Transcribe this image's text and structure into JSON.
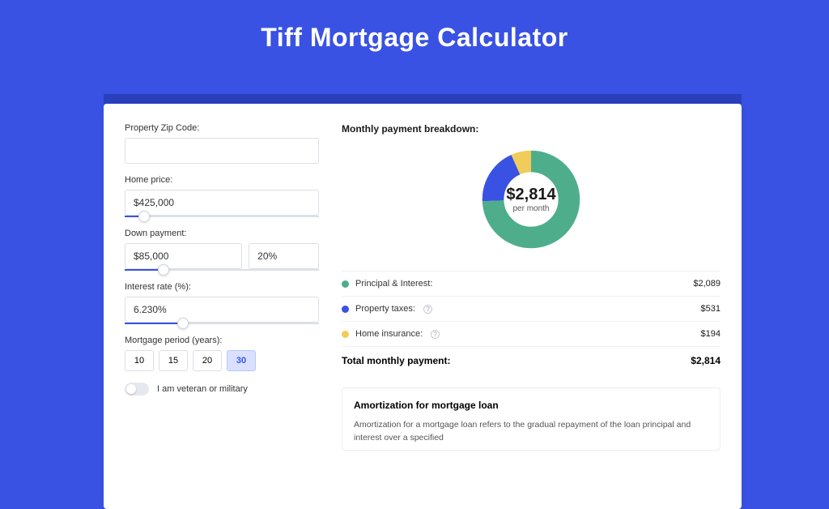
{
  "page": {
    "title": "Tiff Mortgage Calculator"
  },
  "form": {
    "zip_label": "Property Zip Code:",
    "zip_value": "",
    "home_price_label": "Home price:",
    "home_price_value": "$425,000",
    "home_price_slider_pct": 10,
    "down_label": "Down payment:",
    "down_value": "$85,000",
    "down_pct_value": "20%",
    "down_slider_pct": 20,
    "rate_label": "Interest rate (%):",
    "rate_value": "6.230%",
    "rate_slider_pct": 30,
    "period_label": "Mortgage period (years):",
    "period_options": [
      "10",
      "15",
      "20",
      "30"
    ],
    "period_selected": "30",
    "veteran_label": "I am veteran or military",
    "veteran_on": false
  },
  "breakdown": {
    "title": "Monthly payment breakdown:",
    "center_amount": "$2,814",
    "center_sub": "per month",
    "items": [
      {
        "label": "Principal & Interest:",
        "value": "$2,089",
        "color": "green",
        "info": false
      },
      {
        "label": "Property taxes:",
        "value": "$531",
        "color": "blue",
        "info": true
      },
      {
        "label": "Home insurance:",
        "value": "$194",
        "color": "yellow",
        "info": true
      }
    ],
    "total_label": "Total monthly payment:",
    "total_value": "$2,814"
  },
  "chart_data": {
    "type": "pie",
    "title": "Monthly payment breakdown",
    "series": [
      {
        "name": "Principal & Interest",
        "value": 2089,
        "color": "#4eae8c"
      },
      {
        "name": "Property taxes",
        "value": 531,
        "color": "#3952e3"
      },
      {
        "name": "Home insurance",
        "value": 194,
        "color": "#f0cc5a"
      }
    ],
    "total": 2814,
    "center_label": "$2,814 per month"
  },
  "amort": {
    "title": "Amortization for mortgage loan",
    "text": "Amortization for a mortgage loan refers to the gradual repayment of the loan principal and interest over a specified"
  }
}
